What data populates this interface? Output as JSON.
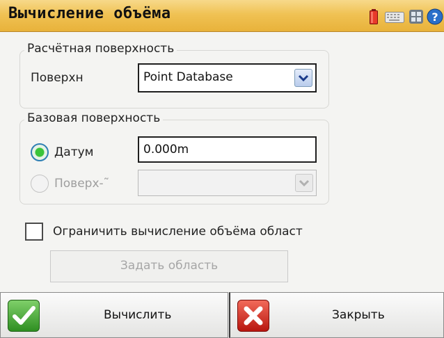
{
  "window": {
    "title": "Вычисление объёма",
    "status_icons": [
      "battery-icon",
      "keyboard-icon",
      "apps-icon",
      "help-icon"
    ]
  },
  "calc_surface": {
    "legend": "Расчётная поверхность",
    "surface_label": "Поверхн",
    "surface_value": "Point Database"
  },
  "base_surface": {
    "legend": "Базовая поверхность",
    "datum_label": "Датум",
    "datum_value": "0.000m",
    "datum_selected": true,
    "surface_label": "Поверх-˜",
    "surface_value": ""
  },
  "limit": {
    "checkbox_label": "Ограничить вычисление объёма област",
    "checked": false,
    "set_area_button": "Задать область"
  },
  "footer": {
    "calculate_label": "Вычислить",
    "close_label": "Закрыть"
  },
  "colors": {
    "title_bar": "#f0c254",
    "radio_selected": "#3ac43a",
    "ok_icon": "#3a9a2a",
    "close_icon": "#d22a2a"
  }
}
